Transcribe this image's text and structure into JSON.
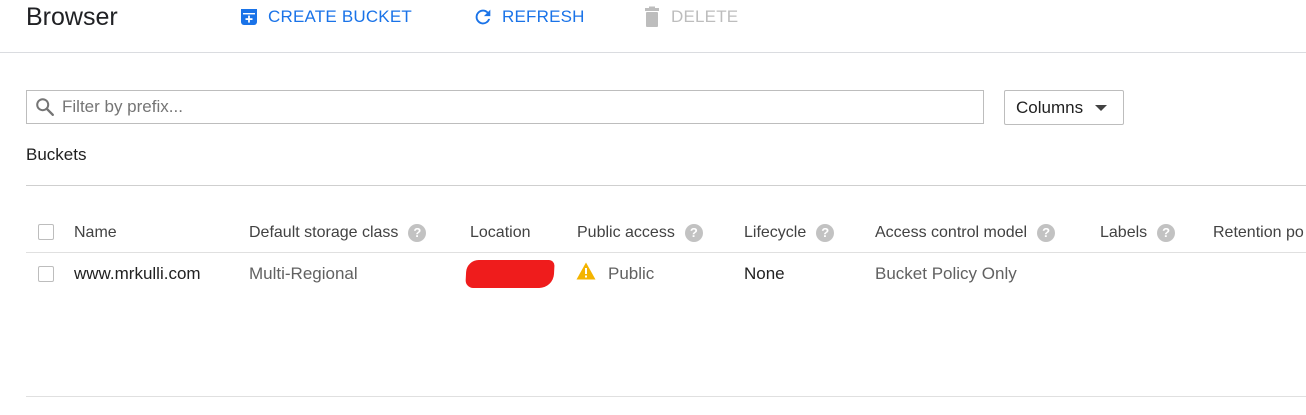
{
  "header": {
    "title": "Browser",
    "actions": {
      "create": "CREATE BUCKET",
      "refresh": "REFRESH",
      "delete": "DELETE"
    }
  },
  "filter": {
    "placeholder": "Filter by prefix...",
    "value": ""
  },
  "columns_button": {
    "label": "Columns"
  },
  "section": {
    "label": "Buckets"
  },
  "table": {
    "headers": {
      "name": "Name",
      "storage_class": "Default storage class",
      "location": "Location",
      "public_access": "Public access",
      "lifecycle": "Lifecycle",
      "access_control": "Access control model",
      "labels": "Labels",
      "retention": "Retention po"
    },
    "rows": [
      {
        "name": "www.mrkulli.com",
        "storage_class": "Multi-Regional",
        "location": "",
        "public_access": "Public",
        "lifecycle": "None",
        "access_control": "Bucket Policy Only",
        "labels": "",
        "retention": ""
      }
    ]
  },
  "colors": {
    "accent": "#1a73e8",
    "disabled": "#bdbdbd",
    "warning": "#f4b400",
    "redaction": "#ef1c1c"
  },
  "icons": {
    "create": "create-bucket-icon",
    "refresh": "refresh-icon",
    "delete": "trash-icon",
    "search": "search-icon",
    "help": "help-icon",
    "warning": "warning-icon"
  }
}
